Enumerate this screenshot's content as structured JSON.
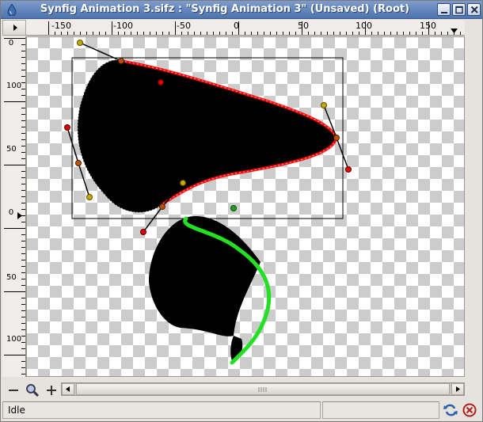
{
  "window": {
    "title": "Synfig Animation 3.sifz : \"Synfig Animation 3\" (Unsaved) (Root)"
  },
  "ruler": {
    "horizontal_labels": [
      "-150",
      "-100",
      "-50",
      "0",
      "50",
      "100",
      "150"
    ],
    "vertical_labels": [
      "0",
      "100",
      "50",
      "0",
      "50",
      "100"
    ]
  },
  "icons": {
    "app": "synfig-drop-icon",
    "minimize": "minimize-icon",
    "maximize": "maximize-icon",
    "close": "close-icon",
    "menu": "menu-arrow-icon",
    "zoom_out": "zoom-out-icon",
    "zoom_fit": "zoom-fit-icon",
    "zoom_in": "zoom-in-icon",
    "refresh": "refresh-icon",
    "stop": "stop-render-icon"
  },
  "colors": {
    "titlebar": "#5a7db5",
    "selected_outline": "#ff0000",
    "second_outline": "#00e000",
    "shape_fill": "#000000"
  },
  "status": {
    "text": "Idle"
  }
}
